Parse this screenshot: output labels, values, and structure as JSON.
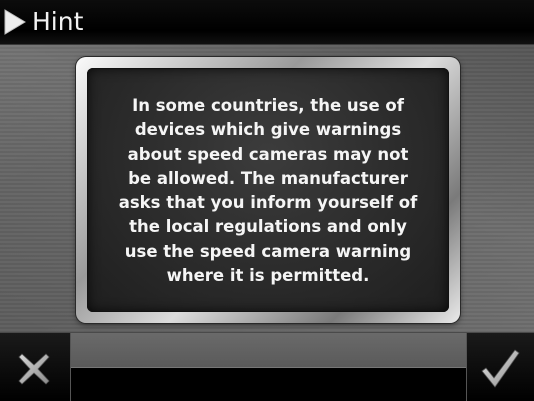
{
  "window": {
    "title": "Hint",
    "title_icon": "play-arrow-icon"
  },
  "dialog": {
    "message_lines": [
      "In some countries, the use of",
      "devices which give warnings",
      "about speed cameras may not",
      "be allowed. The manufacturer",
      "asks that you inform yourself of",
      "the local regulations and only",
      "use the speed camera warning",
      "where it is permitted."
    ]
  },
  "toolbar": {
    "cancel_icon": "close-x-icon",
    "confirm_icon": "checkmark-icon"
  },
  "colors": {
    "title_bar": "#000000",
    "background": "#6c6c6c",
    "panel": "#2e2e2e",
    "text": "#f5f5f5"
  }
}
